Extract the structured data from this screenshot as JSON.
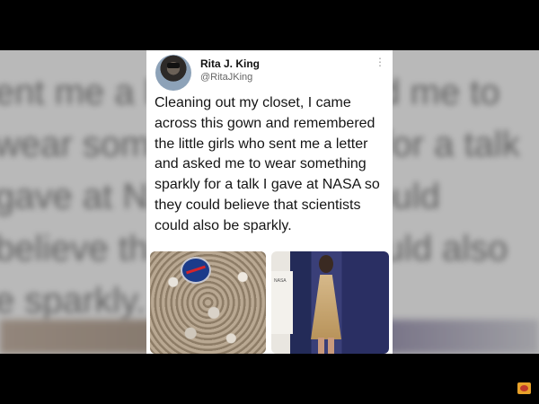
{
  "tweet": {
    "name": "Rita J. King",
    "handle": "@RitaJKing",
    "more_icon": "⋮",
    "text": "Cleaning out my closet, I came across this gown and remembered the little girls who sent me a letter and asked me to wear something sparkly for a talk I gave at NASA so they could believe that scientists could also be sparkly.",
    "photos": [
      {
        "name": "sequin-fabric-photo"
      },
      {
        "name": "speaker-on-stage-photo",
        "sign_text": "NASA"
      }
    ]
  },
  "background": {
    "blurred_text": [
      "ent me a letter and asked me to",
      "wear something sparkly for a talk",
      "gave at NASA so they could",
      "believe that scientists could also",
      "e sparkly."
    ]
  },
  "overlay": {
    "channel_icon": "channel-logo-icon"
  },
  "colors": {
    "letterbox": "#000000",
    "card": "#ffffff",
    "text": "#151515",
    "handle": "#666666"
  }
}
